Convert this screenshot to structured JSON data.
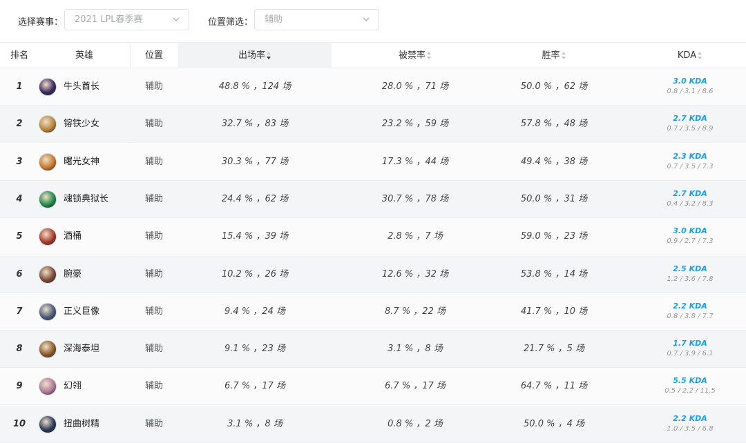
{
  "filters": {
    "event_label": "选择赛事：",
    "event_value": "2021 LPL春季赛",
    "position_label": "位置筛选：",
    "position_value": "辅助"
  },
  "table": {
    "headers": {
      "rank": "排名",
      "hero": "英雄",
      "position": "位置",
      "pick_rate": "出场率",
      "ban_rate": "被禁率",
      "win_rate": "胜率",
      "kda": "KDA"
    },
    "rows": [
      {
        "rank": "1",
        "hero": "牛头酋长",
        "position": "辅助",
        "pick": "48.8 % ，124 场",
        "ban": "28.0 % ，71 场",
        "win": "50.0 % ，62 场",
        "kda": "3.0 KDA",
        "kda_detail": "0.8 / 3.1 / 8.6",
        "avatar_color": "#3b2a5e"
      },
      {
        "rank": "2",
        "hero": "镕铁少女",
        "position": "辅助",
        "pick": "32.7 % ，83 场",
        "ban": "23.2 % ，59 场",
        "win": "57.8 % ，48 场",
        "kda": "2.7 KDA",
        "kda_detail": "0.7 / 3.5 / 8.9",
        "avatar_color": "#b8843a"
      },
      {
        "rank": "3",
        "hero": "曙光女神",
        "position": "辅助",
        "pick": "30.3 % ，77 场",
        "ban": "17.3 % ，44 场",
        "win": "49.4 % ，38 场",
        "kda": "2.3 KDA",
        "kda_detail": "0.7 / 3.5 / 7.3",
        "avatar_color": "#c57a2c"
      },
      {
        "rank": "4",
        "hero": "魂锁典狱长",
        "position": "辅助",
        "pick": "24.4 % ，62 场",
        "ban": "30.7 % ，78 场",
        "win": "50.0 % ，31 场",
        "kda": "2.7 KDA",
        "kda_detail": "0.4 / 3.2 / 8.3",
        "avatar_color": "#1f8a4a"
      },
      {
        "rank": "5",
        "hero": "酒桶",
        "position": "辅助",
        "pick": "15.4 % ，39 场",
        "ban": "2.8 % ，7 场",
        "win": "59.0 % ，23 场",
        "kda": "3.0 KDA",
        "kda_detail": "0.9 / 2.7 / 7.3",
        "avatar_color": "#a83a2a"
      },
      {
        "rank": "6",
        "hero": "腕豪",
        "position": "辅助",
        "pick": "10.2 % ，26 场",
        "ban": "12.6 % ，32 场",
        "win": "53.8 % ，14 场",
        "kda": "2.5 KDA",
        "kda_detail": "1.2 / 3.6 / 7.8",
        "avatar_color": "#7a4a3a"
      },
      {
        "rank": "7",
        "hero": "正义巨像",
        "position": "辅助",
        "pick": "9.4 % ，24 场",
        "ban": "8.7 % ，22 场",
        "win": "41.7 % ，10 场",
        "kda": "2.2 KDA",
        "kda_detail": "0.8 / 3.8 / 7.7",
        "avatar_color": "#4a5a7a"
      },
      {
        "rank": "8",
        "hero": "深海泰坦",
        "position": "辅助",
        "pick": "9.1 % ，23 场",
        "ban": "3.1 % ，8 场",
        "win": "21.7 % ，5 场",
        "kda": "1.7 KDA",
        "kda_detail": "0.7 / 3.9 / 6.1",
        "avatar_color": "#8a5a2a"
      },
      {
        "rank": "9",
        "hero": "幻翎",
        "position": "辅助",
        "pick": "6.7 % ，17 场",
        "ban": "6.7 % ，17 场",
        "win": "64.7 % ，11 场",
        "kda": "5.5 KDA",
        "kda_detail": "0.5 / 2.2 / 11.5",
        "avatar_color": "#b07a9a"
      },
      {
        "rank": "10",
        "hero": "扭曲树精",
        "position": "辅助",
        "pick": "3.1 % ，8 场",
        "ban": "0.8 % ，2 场",
        "win": "50.0 % ，4 场",
        "kda": "2.2 KDA",
        "kda_detail": "1.0 / 3.5 / 6.8",
        "avatar_color": "#2a3a5a"
      }
    ]
  },
  "colors": {
    "kda_accent": "#1a9ff0",
    "sorted_header_bg": "#f2f3f5",
    "row_alt_bg": "#f4f5f7"
  },
  "icons": {
    "select_arrow": "chevron-down-icon",
    "sort": "sort-icon"
  }
}
